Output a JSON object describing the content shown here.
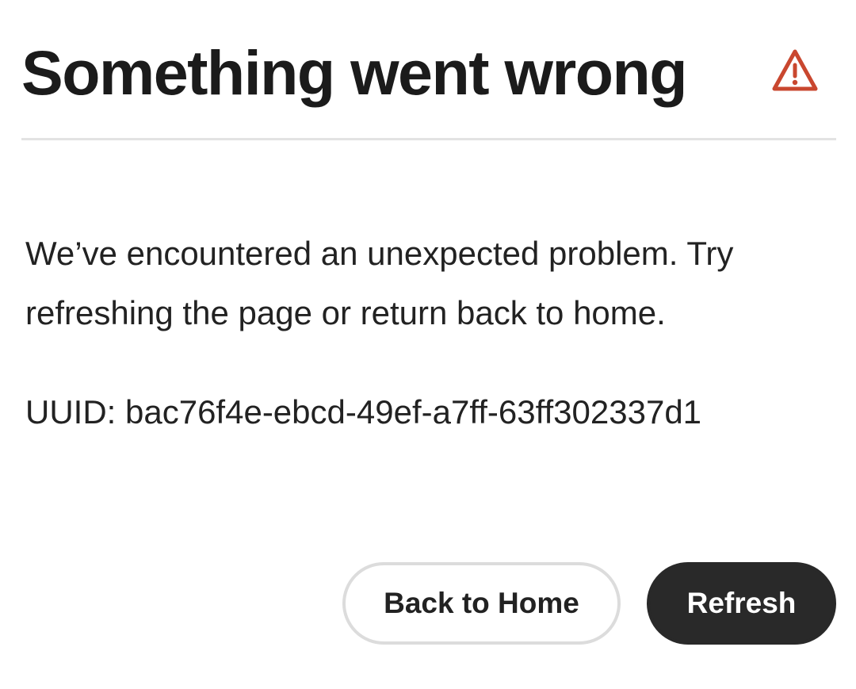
{
  "dialog": {
    "title": "Something went wrong",
    "icon": "alert-triangle-icon",
    "icon_color": "#c9472f",
    "message": "We’ve encountered an unexpected problem. Try refreshing the page or return back to home.",
    "uuid_text": "UUID: bac76f4e-ebcd-49ef-a7ff-63ff302337d1"
  },
  "actions": {
    "back_home_label": "Back to Home",
    "refresh_label": "Refresh"
  },
  "colors": {
    "primary_button_bg": "#292929",
    "secondary_button_border": "#dcdcdc",
    "divider": "#e3e3e3",
    "text": "#222222"
  }
}
